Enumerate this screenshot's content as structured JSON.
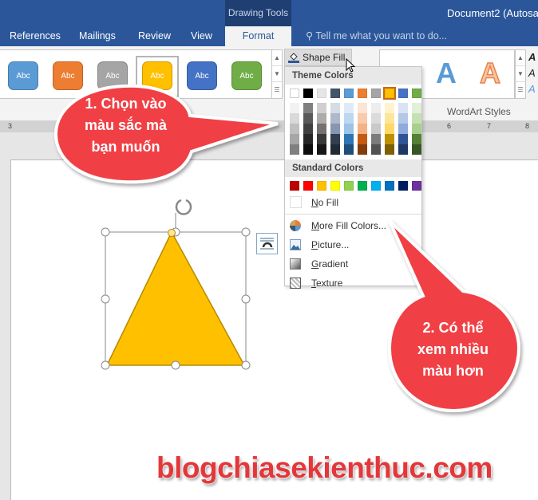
{
  "titlebar": {
    "context_tab": "Drawing Tools",
    "doc_title": "Document2 (Autosav"
  },
  "tabs": [
    {
      "label": "References"
    },
    {
      "label": "Mailings"
    },
    {
      "label": "Review"
    },
    {
      "label": "View"
    },
    {
      "label": "Format",
      "active": true
    }
  ],
  "tellme": "Tell me what you want to do...",
  "ribbon": {
    "shape_styles": [
      {
        "label": "Abc",
        "color": "#5b9bd5"
      },
      {
        "label": "Abc",
        "color": "#ed7d31"
      },
      {
        "label": "Abc",
        "color": "#a5a5a5"
      },
      {
        "label": "Abc",
        "color": "#ffc000"
      },
      {
        "label": "Abc",
        "color": "#4472c4"
      },
      {
        "label": "Abc",
        "color": "#70ad47"
      }
    ],
    "shape_fill_label": "Shape Fill",
    "wordart_letters": [
      "A",
      "A",
      "A"
    ],
    "wordart_group_label": "WordArt Styles"
  },
  "ruler": {
    "ticks": [
      "3",
      "6",
      "7",
      "8"
    ]
  },
  "menu": {
    "theme_header": "Theme Colors",
    "theme_colors": [
      "#ffffff",
      "#000000",
      "#e7e6e6",
      "#44546a",
      "#5b9bd5",
      "#ed7d31",
      "#a5a5a5",
      "#ffc000",
      "#4472c4",
      "#70ad47"
    ],
    "selected_theme_index": 7,
    "shades": [
      [
        "#f2f2f2",
        "#d9d9d9",
        "#bfbfbf",
        "#a6a6a6",
        "#808080"
      ],
      [
        "#808080",
        "#595959",
        "#404040",
        "#262626",
        "#0d0d0d"
      ],
      [
        "#d0cece",
        "#aeabab",
        "#757171",
        "#3a3838",
        "#171616"
      ],
      [
        "#d6dce4",
        "#adb9ca",
        "#8496b0",
        "#333f4f",
        "#222a35"
      ],
      [
        "#deebf6",
        "#bdd7ee",
        "#9dc3e6",
        "#2e75b5",
        "#1f4e79"
      ],
      [
        "#fbe5d5",
        "#f7cbac",
        "#f4b183",
        "#c55a11",
        "#833c0b"
      ],
      [
        "#ededed",
        "#dbdbdb",
        "#c9c9c9",
        "#7b7b7b",
        "#525252"
      ],
      [
        "#fff2cc",
        "#fee599",
        "#ffd965",
        "#bf9000",
        "#7f6000"
      ],
      [
        "#dae3f3",
        "#b4c7e7",
        "#8faadc",
        "#2f5496",
        "#1f3864"
      ],
      [
        "#e2efd9",
        "#c5e0b3",
        "#a8d08d",
        "#538135",
        "#375623"
      ]
    ],
    "standard_header": "Standard Colors",
    "standard_colors": [
      "#c00000",
      "#ff0000",
      "#ffc000",
      "#ffff00",
      "#92d050",
      "#00b050",
      "#00b0f0",
      "#0070c0",
      "#002060",
      "#7030a0"
    ],
    "no_fill": {
      "mnemonic": "N",
      "rest": "o Fill"
    },
    "items": [
      {
        "mnemonic": "M",
        "rest": "ore Fill Colors...",
        "icon": "color-wheel-icon"
      },
      {
        "mnemonic": "P",
        "rest": "icture...",
        "icon": "picture-icon"
      },
      {
        "mnemonic": "G",
        "rest": "radient",
        "icon": "gradient-icon"
      },
      {
        "mnemonic": "T",
        "rest": "exture",
        "icon": "texture-icon"
      }
    ]
  },
  "shape": {
    "fill_color": "#ffc000",
    "type": "Isosceles Triangle"
  },
  "callouts": [
    {
      "lines": [
        "1. Chọn vào",
        "màu sắc mà",
        "bạn muốn"
      ],
      "color": "#f04045"
    },
    {
      "lines": [
        "2. Có thể",
        "xem nhiều",
        "màu hơn"
      ],
      "color": "#f04045"
    }
  ],
  "watermark": "blogchiasekienthuc.com"
}
